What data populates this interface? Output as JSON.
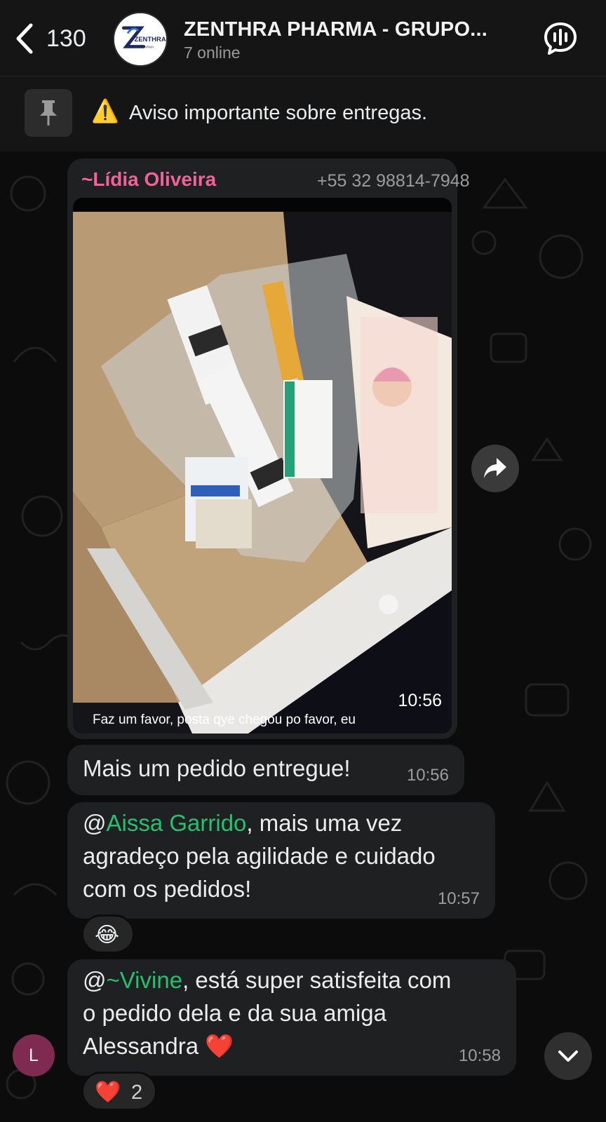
{
  "header": {
    "unread_count": "130",
    "group_title": "ZENTHRA PHARMA - GRUPO...",
    "online_status": "7 online",
    "group_logo_text": "ZENTHRA"
  },
  "pinned": {
    "warning_glyph": "⚠️",
    "text": "Aviso importante sobre entregas."
  },
  "messages": [
    {
      "sender_prefix": "~",
      "sender_name": "Lídia Oliveira",
      "sender_phone": "+55 32 98814-7948",
      "time": "10:56",
      "caption": "Faz um favor,  posta qye chegou po favor,  eu"
    },
    {
      "text": "Mais um pedido entregue!",
      "time": "10:56"
    },
    {
      "at": "@",
      "mention": "Aissa Garrido",
      "line1_rest": ", mais uma vez",
      "line2": "agradeço pela agilidade e cuidado",
      "line3": "com os pedidos!",
      "time": "10:57",
      "reaction": "😂"
    },
    {
      "at": "@",
      "mention": "~Vivine",
      "line1_rest": ", está super satisfeita com",
      "line2": "o pedido dela e da sua amiga",
      "line3": "Alessandra ❤️",
      "time": "10:58",
      "reaction": "❤️",
      "reaction_count": "2"
    }
  ],
  "user_avatar_letter": "L",
  "icons": [
    "back-chevron-icon",
    "voice-chat-icon",
    "pin-icon",
    "forward-icon",
    "chevron-down-icon"
  ],
  "colors": {
    "header_bg": "#151515",
    "bubble_bg": "#1f2021",
    "sender_name": "#f0629a",
    "mention": "#25c16f",
    "avatar_bg": "#7f2a4f"
  }
}
